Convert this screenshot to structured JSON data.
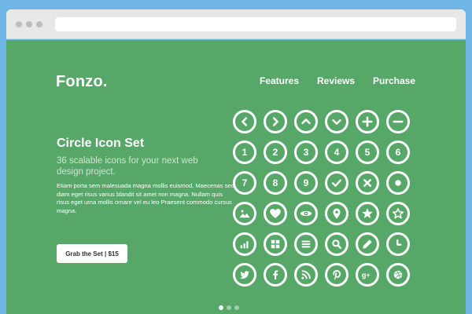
{
  "brand": {
    "logo": "Fonzo."
  },
  "nav": {
    "features": "Features",
    "reviews": "Reviews",
    "purchase": "Purchase"
  },
  "hero": {
    "title": "Circle Icon Set",
    "subtitle": "36 scalable icons for your next web design project.",
    "body": "Etiam porta sem malesuada magna mollis euismod. Maecenas sed diam eget risus varius blandit sit amet non magna. Nullam quis risus eget urna mollis ornare vel eu leo Praesent commodo cursus magna.",
    "cta": "Grab the Set  |  $15"
  },
  "icons": {
    "num1": "1",
    "num2": "2",
    "num3": "3",
    "num4": "4",
    "num5": "5",
    "num6": "6",
    "num7": "7",
    "num8": "8",
    "num9": "9"
  },
  "carousel": {
    "pages": 3,
    "active": 1
  },
  "colors": {
    "sky": "#6fb6e6",
    "page_green": "#56a768",
    "icon_stroke": "#ffffff"
  }
}
